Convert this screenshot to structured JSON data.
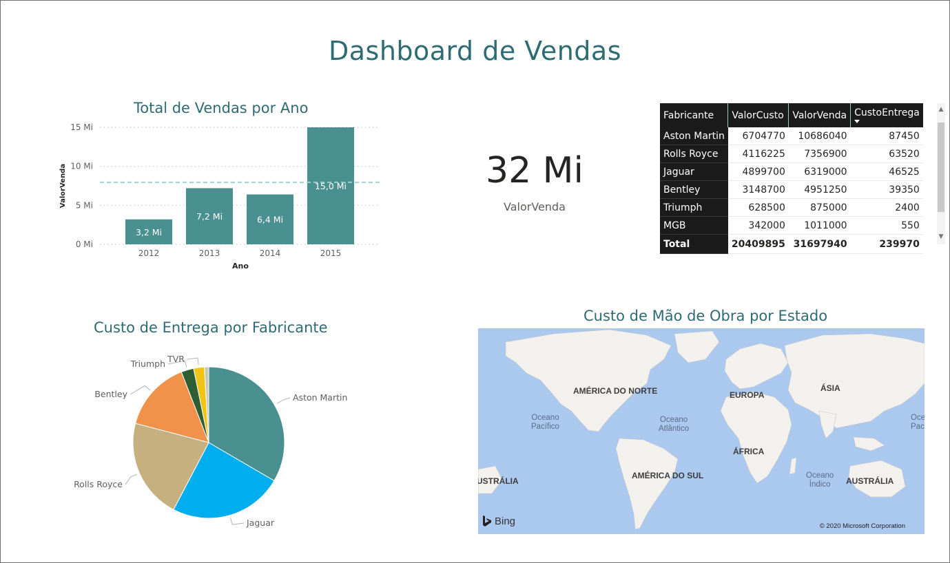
{
  "page": {
    "title": "Dashboard de Vendas"
  },
  "bar_visual": {
    "title": "Total de Vendas por Ano"
  },
  "kpi": {
    "value": "32 Mi",
    "label": "ValorVenda"
  },
  "matrix": {
    "columns": [
      "Fabricante",
      "ValorCusto",
      "ValorVenda",
      "CustoEntrega"
    ],
    "rows": [
      [
        "Aston Martin",
        "6704770",
        "10686040",
        "87450"
      ],
      [
        "Rolls Royce",
        "4116225",
        "7356900",
        "63520"
      ],
      [
        "Jaguar",
        "4899700",
        "6319000",
        "46525"
      ],
      [
        "Bentley",
        "3148700",
        "4951250",
        "39350"
      ],
      [
        "Triumph",
        "628500",
        "875000",
        "2400"
      ],
      [
        "MGB",
        "342000",
        "1011000",
        "550"
      ]
    ],
    "total": [
      "Total",
      "20409895",
      "31697940",
      "239970"
    ]
  },
  "pie_visual": {
    "title": "Custo de Entrega por Fabricante"
  },
  "map_visual": {
    "title": "Custo de Mão de Obra por Estado",
    "continents": [
      "AMÉRICA DO NORTE",
      "EUROPA",
      "ÁSIA",
      "ÁFRICA",
      "AMÉRICA DO SUL",
      "AUSTRÁLIA",
      "USTRÁLIA"
    ],
    "oceans": [
      "Oceano\nPacífico",
      "Oceano\nAtlântico",
      "Oceano\nÍndico",
      "Oce\nPac"
    ],
    "bing_label": "Bing",
    "copyright": "© 2020 Microsoft Corporation",
    "land_color": "#f2f1ee",
    "water_color": "#abc8ee"
  },
  "chart_data": [
    {
      "type": "bar",
      "title": "Total de Vendas por Ano",
      "xlabel": "Ano",
      "ylabel": "ValorVenda",
      "categories": [
        "2012",
        "2013",
        "2014",
        "2015"
      ],
      "values": [
        3.2,
        7.2,
        6.4,
        15.0
      ],
      "data_labels": [
        "3,2 Mi",
        "7,2 Mi",
        "6,4 Mi",
        "15,0 Mi"
      ],
      "y_ticks": [
        "0 Mi",
        "5 Mi",
        "10 Mi",
        "15 Mi"
      ],
      "ylim": [
        0,
        15
      ],
      "average_line": 7.95,
      "color": "#4a9091",
      "grid": true
    },
    {
      "type": "pie",
      "title": "Custo de Entrega por Fabricante",
      "labels": [
        "Aston Martin",
        "Jaguar",
        "Rolls Royce",
        "Bentley",
        "Triumph",
        "TVR",
        ""
      ],
      "values": [
        87450,
        63520,
        56000,
        39350,
        7000,
        6000,
        2400
      ],
      "colors": [
        "#4a9091",
        "#00adef",
        "#c7b07f",
        "#f09249",
        "#2f5e35",
        "#f1c518",
        "#c8c8b8"
      ]
    }
  ]
}
